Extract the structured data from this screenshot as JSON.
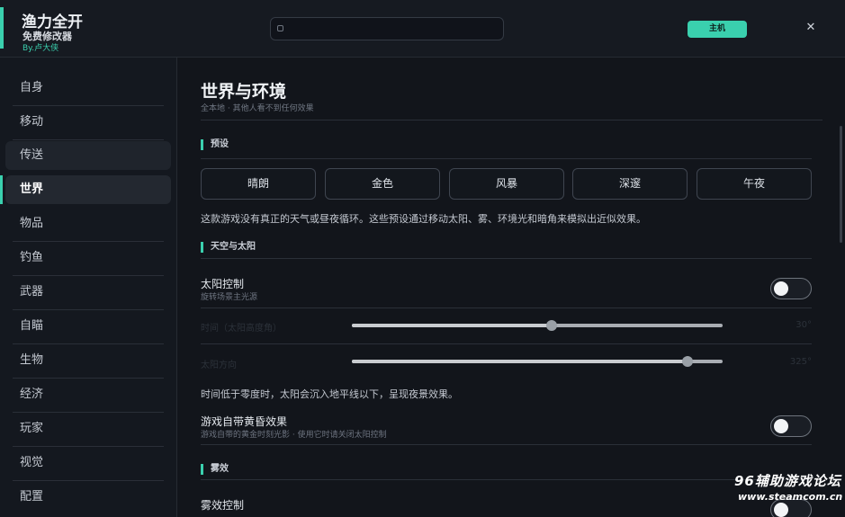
{
  "app": {
    "title": "渔力全开",
    "subtitle": "免费修改器",
    "byline": "By.卢大侠",
    "search": {
      "placeholder": "",
      "value": ""
    },
    "host_button": "主机",
    "close_glyph": "✕"
  },
  "sidebar": {
    "items": [
      {
        "label": "自身"
      },
      {
        "label": "移动"
      },
      {
        "label": "传送"
      },
      {
        "label": "世界"
      },
      {
        "label": "物品"
      },
      {
        "label": "钓鱼"
      },
      {
        "label": "武器"
      },
      {
        "label": "自瞄"
      },
      {
        "label": "生物"
      },
      {
        "label": "经济"
      },
      {
        "label": "玩家"
      },
      {
        "label": "视觉"
      },
      {
        "label": "配置"
      }
    ],
    "active": "世界",
    "hovered": "传送"
  },
  "main": {
    "title": "世界与环境",
    "subtitle": "全本地 · 其他人看不到任何效果",
    "presets_section": "预设",
    "presets": [
      {
        "label": "晴朗"
      },
      {
        "label": "金色"
      },
      {
        "label": "风暴"
      },
      {
        "label": "深邃"
      },
      {
        "label": "午夜"
      }
    ],
    "presets_note": "这款游戏没有真正的天气或昼夜循环。这些预设通过移动太阳、雾、环境光和暗角来模拟出近似效果。",
    "sky_section": "天空与太阳",
    "sun_control": {
      "label": "太阳控制",
      "sub": "旋转场景主光源",
      "enabled": false
    },
    "sliders": [
      {
        "label": "时间（太阳高度角）",
        "value": 0.54,
        "display": "30°"
      },
      {
        "label": "太阳方向",
        "value": 0.905,
        "display": "325°"
      }
    ],
    "sun_note": "时间低于零度时，太阳会沉入地平线以下，呈现夜景效果。",
    "dusk": {
      "label": "游戏自带黄昏效果",
      "sub": "游戏自带的黄金时刻光影 · 使用它时请关闭太阳控制",
      "enabled": false
    },
    "fog_section": "雾效",
    "fog_control": {
      "label": "雾效控制",
      "enabled": false
    }
  },
  "watermark": {
    "line1": "96辅助游戏论坛",
    "line2": "www.steamcom.cn"
  },
  "colors": {
    "accent": "#3ad0ae",
    "background": "#12151b",
    "sidebar": "#14181f",
    "toggle_knob": "#f2f4f6"
  },
  "icons": [
    "search-icon",
    "close-icon"
  ]
}
